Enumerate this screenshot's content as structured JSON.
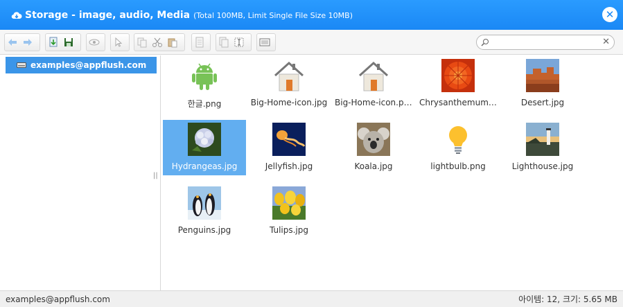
{
  "window": {
    "title": "Storage - image, audio, Media",
    "subtitle": "(Total 100MB, Limit Single File Size 10MB)",
    "close_icon": "close-icon"
  },
  "colors": {
    "titlebar": "#1a88f5",
    "selection": "#62aef0",
    "tree_selection": "#3b95e8"
  },
  "toolbar": {
    "groups": [
      [
        "back-icon",
        "forward-icon"
      ],
      [
        "download-icon",
        "save-icon"
      ],
      [
        "view-icon"
      ],
      [
        "select-icon"
      ],
      [
        "copy-icon",
        "cut-icon",
        "paste-icon"
      ],
      [
        "file-icon"
      ],
      [
        "duplicate-icon",
        "rename-icon"
      ],
      [
        "list-view-icon"
      ]
    ]
  },
  "search": {
    "value": "",
    "placeholder": ""
  },
  "sidebar": {
    "items": [
      {
        "label": "examples@appflush.com",
        "icon": "drive-icon",
        "selected": true
      }
    ]
  },
  "files": [
    {
      "name": "한글.png",
      "thumb": "android"
    },
    {
      "name": "Big-Home-icon.jpg",
      "thumb": "home"
    },
    {
      "name": "Big-Home-icon.png",
      "thumb": "home"
    },
    {
      "name": "Chrysanthemum.j...",
      "thumb": "chrysanthemum"
    },
    {
      "name": "Desert.jpg",
      "thumb": "desert"
    },
    {
      "name": "Hydrangeas.jpg",
      "thumb": "hydrangeas",
      "selected": true
    },
    {
      "name": "Jellyfish.jpg",
      "thumb": "jellyfish"
    },
    {
      "name": "Koala.jpg",
      "thumb": "koala"
    },
    {
      "name": "lightbulb.png",
      "thumb": "lightbulb"
    },
    {
      "name": "Lighthouse.jpg",
      "thumb": "lighthouse"
    },
    {
      "name": "Penguins.jpg",
      "thumb": "penguins"
    },
    {
      "name": "Tulips.jpg",
      "thumb": "tulips"
    }
  ],
  "status": {
    "left": "examples@appflush.com",
    "right": "아이템: 12, 크기: 5.65 MB"
  }
}
